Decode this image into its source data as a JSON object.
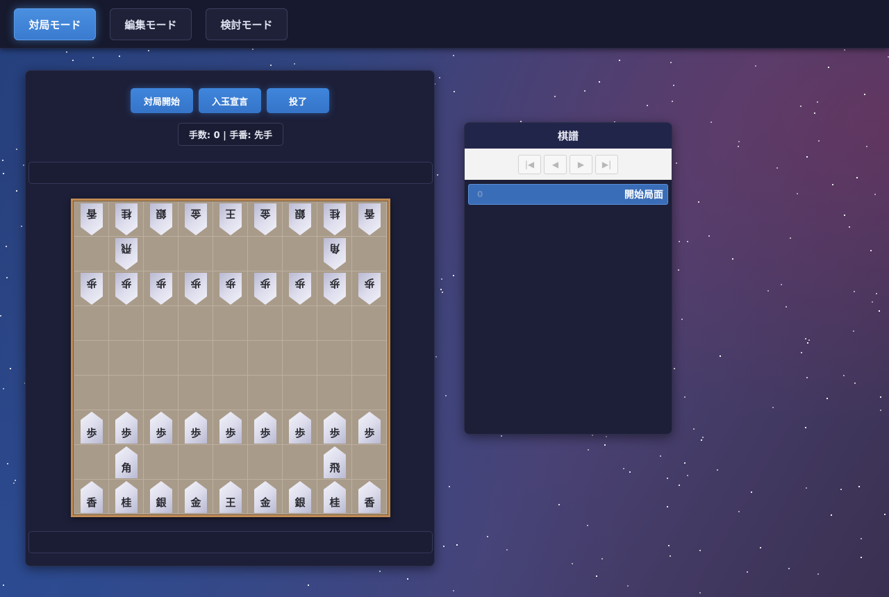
{
  "mode_bar": {
    "modes": [
      {
        "label": "対局モード",
        "active": true
      },
      {
        "label": "編集モード",
        "active": false
      },
      {
        "label": "検討モード",
        "active": false
      }
    ]
  },
  "game": {
    "buttons": {
      "start": "対局開始",
      "declare": "入玉宣言",
      "resign": "投了"
    },
    "status": "手数: 0 | 手番: 先手"
  },
  "board": {
    "rows": [
      [
        {
          "p": "香",
          "o": "gote"
        },
        {
          "p": "桂",
          "o": "gote"
        },
        {
          "p": "銀",
          "o": "gote"
        },
        {
          "p": "金",
          "o": "gote"
        },
        {
          "p": "王",
          "o": "gote"
        },
        {
          "p": "金",
          "o": "gote"
        },
        {
          "p": "銀",
          "o": "gote"
        },
        {
          "p": "桂",
          "o": "gote"
        },
        {
          "p": "香",
          "o": "gote"
        }
      ],
      [
        null,
        {
          "p": "飛",
          "o": "gote"
        },
        null,
        null,
        null,
        null,
        null,
        {
          "p": "角",
          "o": "gote"
        },
        null
      ],
      [
        {
          "p": "歩",
          "o": "gote"
        },
        {
          "p": "歩",
          "o": "gote"
        },
        {
          "p": "歩",
          "o": "gote"
        },
        {
          "p": "歩",
          "o": "gote"
        },
        {
          "p": "歩",
          "o": "gote"
        },
        {
          "p": "歩",
          "o": "gote"
        },
        {
          "p": "歩",
          "o": "gote"
        },
        {
          "p": "歩",
          "o": "gote"
        },
        {
          "p": "歩",
          "o": "gote"
        }
      ],
      [
        null,
        null,
        null,
        null,
        null,
        null,
        null,
        null,
        null
      ],
      [
        null,
        null,
        null,
        null,
        null,
        null,
        null,
        null,
        null
      ],
      [
        null,
        null,
        null,
        null,
        null,
        null,
        null,
        null,
        null
      ],
      [
        {
          "p": "歩",
          "o": "sente"
        },
        {
          "p": "歩",
          "o": "sente"
        },
        {
          "p": "歩",
          "o": "sente"
        },
        {
          "p": "歩",
          "o": "sente"
        },
        {
          "p": "歩",
          "o": "sente"
        },
        {
          "p": "歩",
          "o": "sente"
        },
        {
          "p": "歩",
          "o": "sente"
        },
        {
          "p": "歩",
          "o": "sente"
        },
        {
          "p": "歩",
          "o": "sente"
        }
      ],
      [
        null,
        {
          "p": "角",
          "o": "sente"
        },
        null,
        null,
        null,
        null,
        null,
        {
          "p": "飛",
          "o": "sente"
        },
        null
      ],
      [
        {
          "p": "香",
          "o": "sente"
        },
        {
          "p": "桂",
          "o": "sente"
        },
        {
          "p": "銀",
          "o": "sente"
        },
        {
          "p": "金",
          "o": "sente"
        },
        {
          "p": "王",
          "o": "sente"
        },
        {
          "p": "金",
          "o": "sente"
        },
        {
          "p": "銀",
          "o": "sente"
        },
        {
          "p": "桂",
          "o": "sente"
        },
        {
          "p": "香",
          "o": "sente"
        }
      ]
    ]
  },
  "kifu": {
    "title": "棋譜",
    "nav": [
      {
        "name": "first",
        "glyph": "|◀"
      },
      {
        "name": "prev",
        "glyph": "◀"
      },
      {
        "name": "next",
        "glyph": "▶"
      },
      {
        "name": "last",
        "glyph": "▶|"
      }
    ],
    "entries": [
      {
        "num": "0",
        "label": "開始局面"
      }
    ]
  },
  "colors": {
    "accent": "#3f86dc",
    "panel": "#1d1f38",
    "board": "#a99b8a",
    "board_border": "#c28c54"
  }
}
